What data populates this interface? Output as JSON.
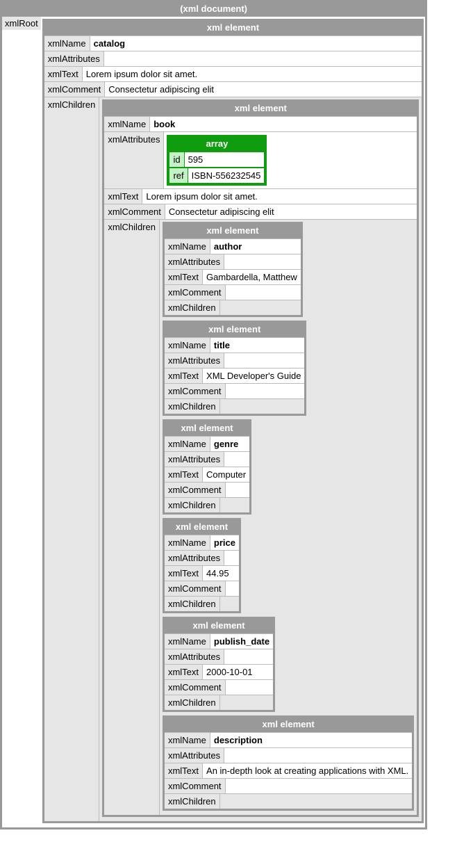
{
  "labels": {
    "xmlDocument": "(xml document)",
    "xmlElement": "xml element",
    "xmlRoot": "xmlRoot",
    "xmlName": "xmlName",
    "xmlAttributes": "xmlAttributes",
    "xmlText": "xmlText",
    "xmlComment": "xmlComment",
    "xmlChildren": "xmlChildren",
    "array": "array"
  },
  "root": {
    "name": "catalog",
    "attributes": "",
    "text": "Lorem ipsum dolor sit amet.",
    "comment": "Consectetur adipiscing elit",
    "child": {
      "name": "book",
      "attributes": [
        {
          "key": "id",
          "value": "595"
        },
        {
          "key": "ref",
          "value": "ISBN-556232545"
        }
      ],
      "text": "Lorem ipsum dolor sit amet.",
      "comment": "Consectetur adipiscing elit",
      "children": [
        {
          "name": "author",
          "attributes": "",
          "text": "Gambardella, Matthew",
          "comment": "",
          "children": ""
        },
        {
          "name": "title",
          "attributes": "",
          "text": "XML Developer's Guide",
          "comment": "",
          "children": ""
        },
        {
          "name": "genre",
          "attributes": "",
          "text": "Computer",
          "comment": "",
          "children": ""
        },
        {
          "name": "price",
          "attributes": "",
          "text": "44.95",
          "comment": "",
          "children": ""
        },
        {
          "name": "publish_date",
          "attributes": "",
          "text": "2000-10-01",
          "comment": "",
          "children": ""
        },
        {
          "name": "description",
          "attributes": "",
          "text": "An in-depth look at creating applications with XML.",
          "comment": "",
          "children": ""
        }
      ]
    }
  }
}
